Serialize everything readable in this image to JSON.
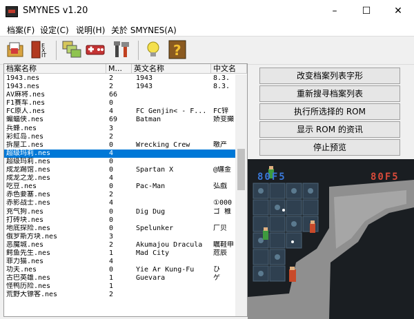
{
  "window": {
    "title": "SMYNES v1.20"
  },
  "menu": [
    "档案(F)",
    "设定(C)",
    "说明(H)",
    "关於 SMYNES(A)"
  ],
  "columns": [
    "档案名称",
    "M...",
    "英文名称",
    "中文名"
  ],
  "rows": [
    {
      "file": "1943.nes",
      "m": "2",
      "en": "1943",
      "cn": "8.3."
    },
    {
      "file": "1943.nes",
      "m": "2",
      "en": "1943",
      "cn": "8.3."
    },
    {
      "file": "AV麻将.nes",
      "m": "66",
      "en": "",
      "cn": ""
    },
    {
      "file": "F1赛车.nes",
      "m": "0",
      "en": "",
      "cn": ""
    },
    {
      "file": "FC原人.nes",
      "m": "4",
      "en": "FC Genjin< - F...",
      "cn": "FC锌"
    },
    {
      "file": "蝙蝠侠.nes",
      "m": "69",
      "en": "Batman",
      "cn": "娇变攧"
    },
    {
      "file": "兵蜂.nes",
      "m": "3",
      "en": "",
      "cn": ""
    },
    {
      "file": "彩虹岛.nes",
      "m": "2",
      "en": "",
      "cn": ""
    },
    {
      "file": "拆屋工.nes",
      "m": "0",
      "en": "Wrecking Crew",
      "cn": "曒产"
    },
    {
      "file": "超级玛莉.nes",
      "m": "4",
      "en": "",
      "cn": ""
    },
    {
      "file": "超级玛莉.nes",
      "m": "0",
      "en": "",
      "cn": ""
    },
    {
      "file": "成龙踢馆.nes",
      "m": "0",
      "en": "Spartan X",
      "cn": "@纏金"
    },
    {
      "file": "成龙之龙.nes",
      "m": "4",
      "en": "",
      "cn": ""
    },
    {
      "file": "吃豆.nes",
      "m": "0",
      "en": "Pac-Man",
      "cn": "弘戲"
    },
    {
      "file": "赤色要塞.nes",
      "m": "2",
      "en": "",
      "cn": ""
    },
    {
      "file": "赤影战士.nes",
      "m": "4",
      "en": "",
      "cn": "①000"
    },
    {
      "file": "充气狗.nes",
      "m": "0",
      "en": "Dig Dug",
      "cn": "ゴ 稚"
    },
    {
      "file": "打砖块.nes",
      "m": "0",
      "en": "",
      "cn": ""
    },
    {
      "file": "地底探险.nes",
      "m": "0",
      "en": "Spelunker",
      "cn": "厂贝"
    },
    {
      "file": "俄罗斯方块.nes",
      "m": "3",
      "en": "",
      "cn": ""
    },
    {
      "file": "恶魔城.nes",
      "m": "2",
      "en": "Akumajou Dracula",
      "cn": "瞩鞋申"
    },
    {
      "file": "鳄鱼先生.nes",
      "m": "1",
      "en": "Mad City",
      "cn": "苊辰"
    },
    {
      "file": "菲力猫.nes",
      "m": "4",
      "en": "",
      "cn": ""
    },
    {
      "file": "功夫.nes",
      "m": "0",
      "en": "Yie Ar Kung-Fu",
      "cn": "ひ"
    },
    {
      "file": "古巴英雄.nes",
      "m": "1",
      "en": "Guevara",
      "cn": "ゲ"
    },
    {
      "file": "怪鸭历险.nes",
      "m": "1",
      "en": "",
      "cn": ""
    },
    {
      "file": "荒野大镖客.nes",
      "m": "2",
      "en": "",
      "cn": ""
    },
    {
      "file": "",
      "m": "",
      "en": "",
      "cn": ""
    }
  ],
  "selected_row": 9,
  "buttons": [
    "改变档案列表字形",
    "重新搜寻档案列表",
    "执行所选择的 ROM",
    "显示 ROM 的资讯",
    "停止预览"
  ],
  "game": {
    "score_left": "80F5",
    "score_right": "80F5"
  }
}
